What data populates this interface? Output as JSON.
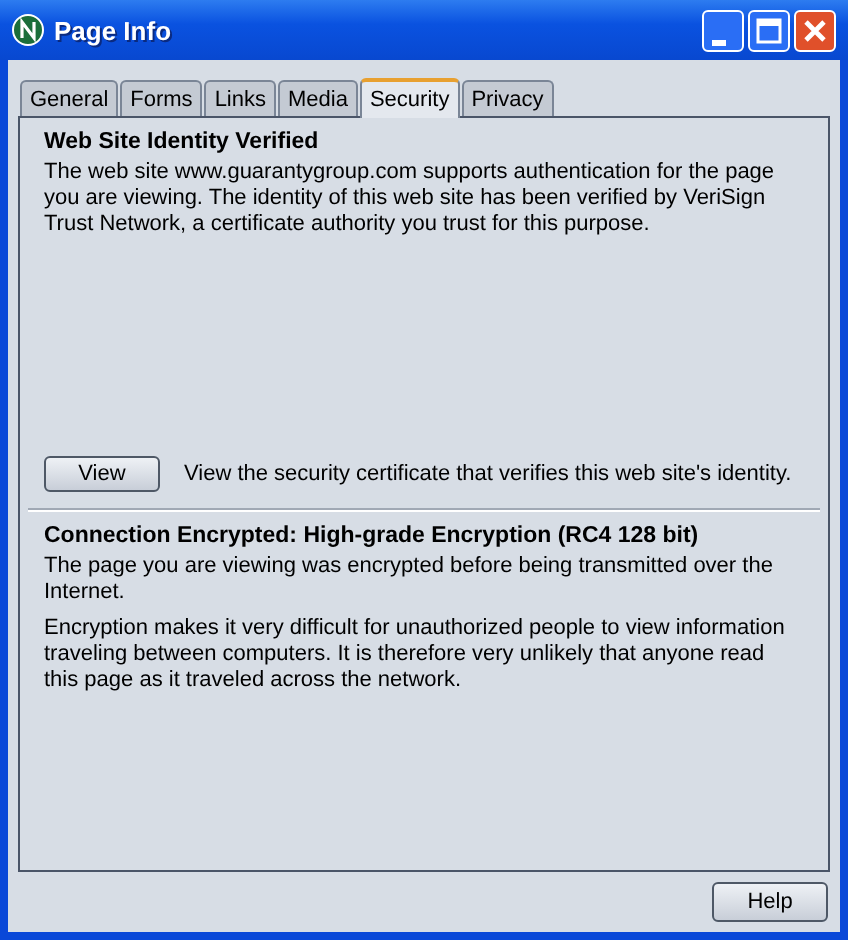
{
  "window": {
    "title": "Page Info"
  },
  "tabs": [
    {
      "label": "General",
      "selected": false
    },
    {
      "label": "Forms",
      "selected": false
    },
    {
      "label": "Links",
      "selected": false
    },
    {
      "label": "Media",
      "selected": false
    },
    {
      "label": "Security",
      "selected": true
    },
    {
      "label": "Privacy",
      "selected": false
    }
  ],
  "identity": {
    "heading": "Web Site Identity Verified",
    "text": "The web site www.guarantygroup.com supports authentication for the page you are viewing. The identity of this web site has been verified by VeriSign Trust Network, a certificate authority you trust for this purpose.",
    "button": "View",
    "button_note": "View the security certificate that verifies this web site's identity."
  },
  "encryption": {
    "heading": "Connection Encrypted: High-grade Encryption (RC4 128 bit)",
    "paragraphs": [
      "The page you are viewing was encrypted before being transmitted over the Internet.",
      "Encryption makes it very difficult for unauthorized people to view information traveling between computers. It is therefore very unlikely that anyone read this page as it traveled across the network."
    ]
  },
  "buttons": [
    "Help"
  ]
}
